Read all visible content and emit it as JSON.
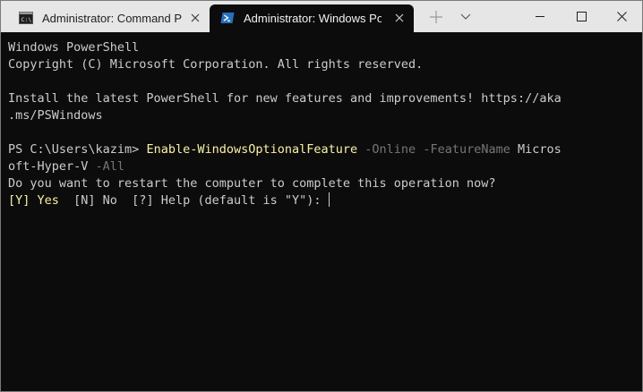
{
  "tabs": [
    {
      "title": "Administrator: Command Prompt",
      "icon": "cmd-icon",
      "active": false
    },
    {
      "title": "Administrator: Windows PowerShell",
      "icon": "powershell-icon",
      "active": true
    }
  ],
  "titlebar": {
    "new_tab": "new-tab-icon",
    "dropdown": "chevron-down-icon",
    "minimize": "minimize-icon",
    "maximize": "maximize-icon",
    "close": "close-icon"
  },
  "colors": {
    "terminal_bg": "#0c0c0c",
    "foreground": "#cccccc",
    "command_yellow": "#f9f1a5",
    "parameter_gray": "#767676",
    "titlebar_bg": "#e6e6e6"
  },
  "terminal": {
    "banner": {
      "line1": "Windows PowerShell",
      "line2": "Copyright (C) Microsoft Corporation. All rights reserved."
    },
    "notice": {
      "line1": "Install the latest PowerShell for new features and improvements! https://aka",
      "line2": ".ms/PSWindows"
    },
    "command": {
      "prompt": "PS C:\\Users\\kazim> ",
      "cmdlet": "Enable-WindowsOptionalFeature",
      "param1": "-Online",
      "param2": "-FeatureName",
      "value_part1": "Micros",
      "value_part2": "oft-Hyper-V",
      "param3": "-All"
    },
    "question": "Do you want to restart the computer to complete this operation now?",
    "choices": {
      "yes": "[Y] Yes",
      "rest": "  [N] No  [?] Help (default is \"Y\"): "
    }
  }
}
